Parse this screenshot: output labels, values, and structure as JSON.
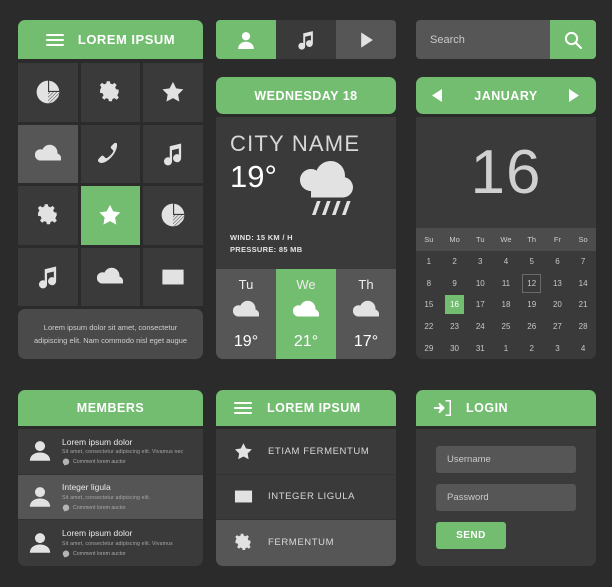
{
  "colors": {
    "accent": "#73bd71",
    "background": "#2b2b2b",
    "tile": "#3a3a3a",
    "tile_light": "#565656"
  },
  "col1": {
    "header": {
      "title": "LOREM IPSUM"
    },
    "tiles": [
      {
        "icon": "pie-chart-icon",
        "state": "dark"
      },
      {
        "icon": "gear-icon",
        "state": "dark"
      },
      {
        "icon": "star-icon",
        "state": "dark"
      },
      {
        "icon": "cloud-icon",
        "state": "light"
      },
      {
        "icon": "phone-icon",
        "state": "dark"
      },
      {
        "icon": "music-note-icon",
        "state": "dark"
      },
      {
        "icon": "gear-icon",
        "state": "dark"
      },
      {
        "icon": "star-icon",
        "state": "green"
      },
      {
        "icon": "pie-chart-icon",
        "state": "dark"
      },
      {
        "icon": "music-note-icon",
        "state": "dark"
      },
      {
        "icon": "cloud-icon",
        "state": "dark"
      },
      {
        "icon": "envelope-icon",
        "state": "dark"
      }
    ],
    "footer_text": "Lorem ipsum dolor sit amet, consectetur adipiscing elit. Nam commodo nisl eget augue"
  },
  "members": {
    "header": "MEMBERS",
    "items": [
      {
        "name": "Lorem ipsum dolor",
        "desc": "Sit amet, consectetur adipiscing elit. Vivamus nec",
        "comment": "Comment lorem auctor",
        "state": "normal"
      },
      {
        "name": "Integer ligula",
        "desc": "Sit amet, consectetur adipiscing elit.",
        "comment": "Comment lorem auctor",
        "state": "hover"
      },
      {
        "name": "Lorem ipsum dolor",
        "desc": "Sit amet, consectetur adipiscing elit. Vivamus",
        "comment": "Comment lorem auctor",
        "state": "normal"
      }
    ]
  },
  "col2": {
    "segmented": [
      {
        "icon": "user-icon",
        "state": "active"
      },
      {
        "icon": "music-note-icon",
        "state": "normal"
      },
      {
        "icon": "play-icon",
        "state": "hover"
      }
    ],
    "day_header": "WEDNESDAY 18",
    "weather": {
      "city": "CITY NAME",
      "temperature": "19°",
      "condition_icon": "rain-cloud-icon",
      "wind": "WIND: 15 KM / H",
      "pressure": "PRESSURE: 85 MB",
      "forecast": [
        {
          "day": "Tu",
          "icon": "cloud-icon",
          "temp": "19°",
          "state": "normal"
        },
        {
          "day": "We",
          "icon": "cloud-icon",
          "temp": "21°",
          "state": "active"
        },
        {
          "day": "Th",
          "icon": "cloud-icon",
          "temp": "17°",
          "state": "normal"
        }
      ]
    }
  },
  "menu": {
    "header": "LOREM IPSUM",
    "items": [
      {
        "label": "ETIAM FERMENTUM",
        "icon": "star-icon",
        "state": "normal"
      },
      {
        "label": "INTEGER LIGULA",
        "icon": "envelope-icon",
        "state": "normal"
      },
      {
        "label": "FERMENTUM",
        "icon": "gear-icon",
        "state": "hover"
      }
    ]
  },
  "search": {
    "placeholder": "Search",
    "button_icon": "search-icon"
  },
  "calendar": {
    "month": "JANUARY",
    "prev_icon": "chevron-left-icon",
    "next_icon": "chevron-right-icon",
    "big_day": "16",
    "dow": [
      "Su",
      "Mo",
      "Tu",
      "We",
      "Th",
      "Fr",
      "So"
    ],
    "days": [
      {
        "n": "1"
      },
      {
        "n": "2"
      },
      {
        "n": "3"
      },
      {
        "n": "4"
      },
      {
        "n": "5"
      },
      {
        "n": "6"
      },
      {
        "n": "7"
      },
      {
        "n": "8"
      },
      {
        "n": "9"
      },
      {
        "n": "10"
      },
      {
        "n": "11"
      },
      {
        "n": "12",
        "state": "outlined"
      },
      {
        "n": "13"
      },
      {
        "n": "14"
      },
      {
        "n": "15"
      },
      {
        "n": "16",
        "state": "selected"
      },
      {
        "n": "17"
      },
      {
        "n": "18"
      },
      {
        "n": "19"
      },
      {
        "n": "20"
      },
      {
        "n": "21"
      },
      {
        "n": "22"
      },
      {
        "n": "23"
      },
      {
        "n": "24"
      },
      {
        "n": "25"
      },
      {
        "n": "26"
      },
      {
        "n": "27"
      },
      {
        "n": "28"
      },
      {
        "n": "29"
      },
      {
        "n": "30"
      },
      {
        "n": "31"
      },
      {
        "n": "1"
      },
      {
        "n": "2"
      },
      {
        "n": "3"
      },
      {
        "n": "4"
      }
    ]
  },
  "login": {
    "header": "LOGIN",
    "header_icon": "login-arrow-icon",
    "username_placeholder": "Username",
    "password_placeholder": "Password",
    "send_label": "SEND"
  }
}
